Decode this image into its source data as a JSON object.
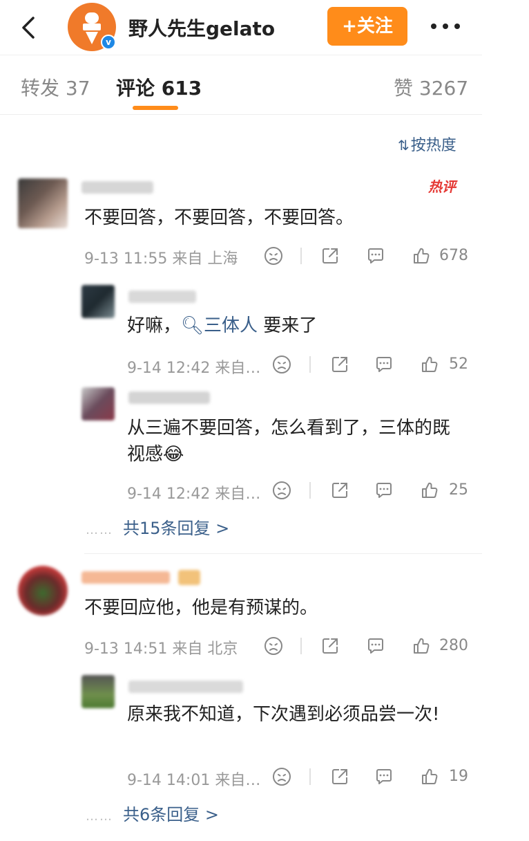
{
  "header": {
    "username": "野人先生gelato",
    "follow_label": "+关注",
    "verified_mark": "v"
  },
  "tabs": [
    {
      "label": "转发 37"
    },
    {
      "label": "评论 613"
    },
    {
      "label": "赞 3267"
    }
  ],
  "sort_label": "按热度",
  "hot_badge": "热评",
  "comments": [
    {
      "text": "不要回答，不要回答，不要回答。",
      "time": "9-13 11:55",
      "location": "来自 上海",
      "likes": "678",
      "replies": [
        {
          "text_before": "好嘛，",
          "link": "三体人",
          "text_after": " 要来了",
          "time": "9-14 12:42",
          "location": "来自…",
          "likes": "52"
        },
        {
          "text": "从三遍不要回答，怎么看到了，三体的既视感😂",
          "time": "9-14 12:42",
          "location": "来自…",
          "likes": "25"
        }
      ],
      "more_replies": "共15条回复 >"
    },
    {
      "text": "不要回应他，他是有预谋的。",
      "time": "9-13 14:51",
      "location": "来自 北京",
      "likes": "280",
      "replies": [
        {
          "text": "原来我不知道，下次遇到必须品尝一次!",
          "time": "9-14 14:01",
          "location": "来自…",
          "likes": "19"
        }
      ],
      "more_replies": "共6条回复 >"
    }
  ],
  "colors": {
    "accent": "#ff8c1a",
    "link": "#3a5f8a",
    "hot": "#e53935"
  }
}
